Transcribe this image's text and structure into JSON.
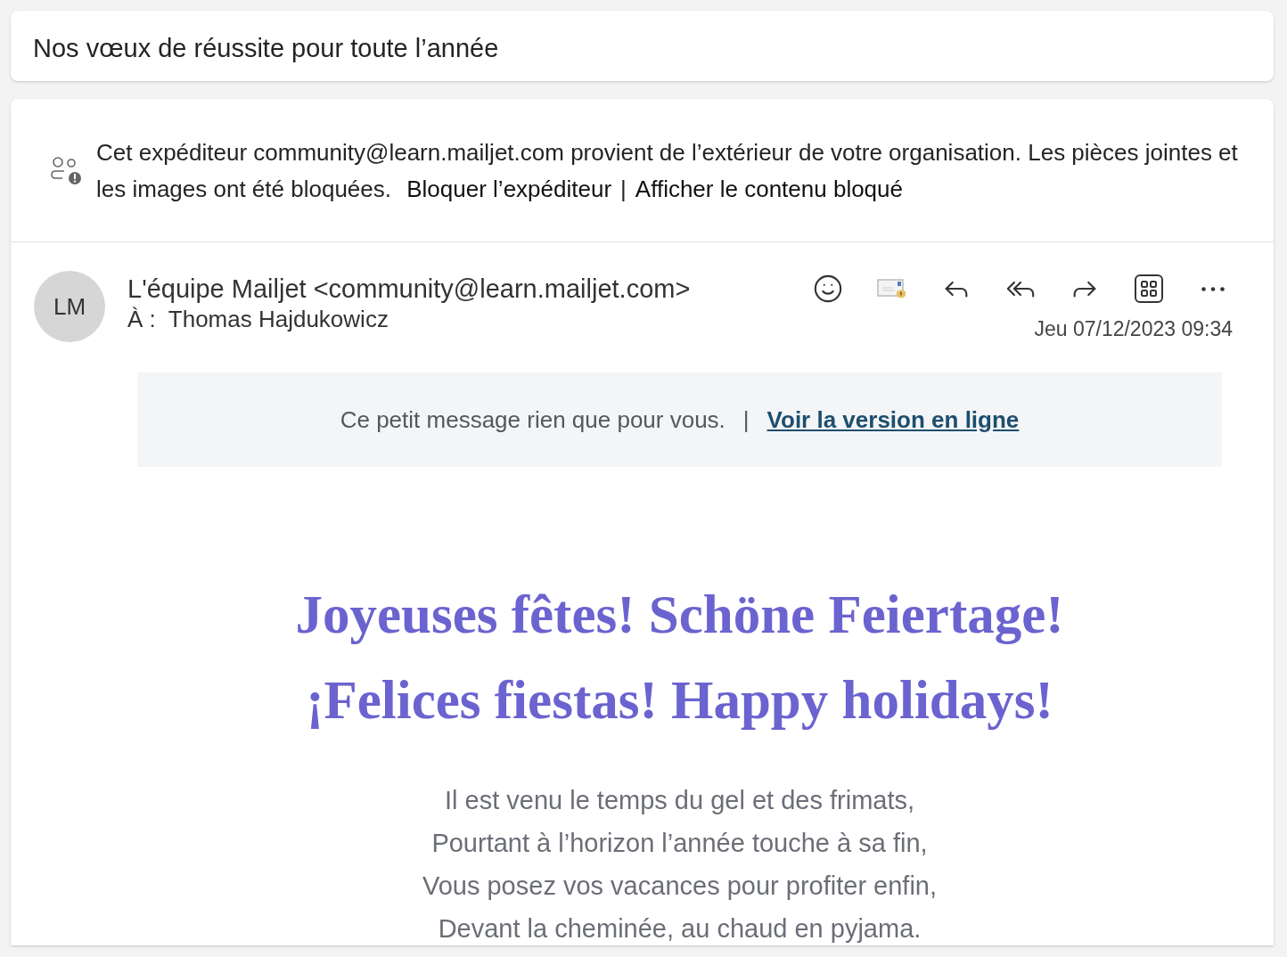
{
  "subject": "Nos vœux de réussite pour toute l’année",
  "warning": {
    "text": "Cet expéditeur community@learn.mailjet.com provient de l’extérieur de votre organisation. Les pièces jointes et les images ont été bloquées.",
    "links": [
      "Bloquer l’expéditeur",
      "Afficher le contenu bloqué"
    ],
    "separator": "|"
  },
  "sender": {
    "initials": "LM",
    "name": "L'équipe Mailjet <community@learn.mailjet.com>",
    "to_label": "À :",
    "to": "Thomas Hajdukowicz",
    "date": "Jeu 07/12/2023 09:34"
  },
  "actions": [
    {
      "kind": "emoji"
    },
    {
      "kind": "envelope-warning"
    },
    {
      "kind": "reply"
    },
    {
      "kind": "reply-all"
    },
    {
      "kind": "forward"
    },
    {
      "kind": "apps"
    },
    {
      "kind": "more"
    }
  ],
  "banner": {
    "text": "Ce petit message rien que pour vous.",
    "separator": "|",
    "link": "Voir la version en ligne"
  },
  "heading": [
    "Joyeuses fêtes! Schöne Feiertage!",
    "¡Felices fiestas! Happy holidays!"
  ],
  "poem": [
    "Il est venu le temps du gel et des frimats,",
    "Pourtant à l’horizon l’année touche à sa fin,",
    "Vous posez vos vacances pour profiter enfin,",
    "Devant la cheminée, au chaud en pyjama."
  ]
}
